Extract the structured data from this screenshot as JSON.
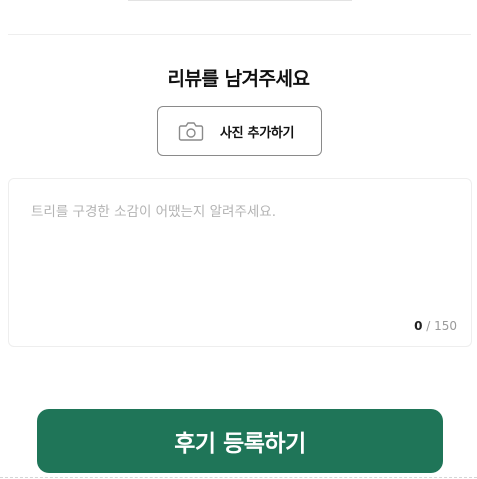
{
  "review": {
    "heading": "리뷰를 남겨주세요",
    "photo_button": {
      "label": "사진 추가하기",
      "icon": "camera-icon"
    },
    "textarea": {
      "placeholder": "트리를 구경한 소감이 어땠는지 알려주세요.",
      "value": ""
    },
    "counter": {
      "current": "0",
      "separator": " / ",
      "max": "150"
    },
    "submit_label": "후기 등록하기"
  },
  "colors": {
    "accent": "#1f7558",
    "border": "#8a8a8a",
    "placeholder": "#b3b3b3"
  }
}
